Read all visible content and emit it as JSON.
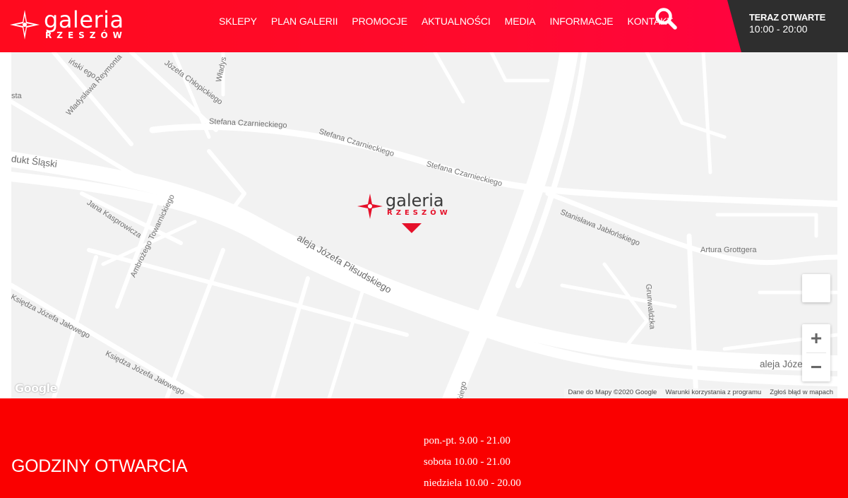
{
  "header": {
    "logo": {
      "line1": "galeria",
      "line2": "RZESZÓW"
    },
    "nav": [
      "SKLEPY",
      "PLAN GALERII",
      "PROMOCJE",
      "AKTUALNOŚCI",
      "MEDIA",
      "INFORMACJE",
      "KONTAKT"
    ],
    "search_icon": "search-icon",
    "open_now": {
      "label": "TERAZ OTWARTE",
      "hours": "10:00 - 20:00"
    }
  },
  "map": {
    "streets": [
      "iński ego",
      "Władysława Reymonta",
      "Józefa Chłopickiego",
      "Władys",
      "sta",
      "Stefana Czarnieckiego",
      "Stefana Czarnieckiego",
      "Stefana Czarnieckiego",
      "dukt Śląski",
      "Jana Kasprowicza",
      "Ambrożego Towarnickiego",
      "aleja Józefa Piłsudskiego",
      "Stanisława Jabłońskiego",
      "Artura Grottgera",
      "Grunwaldzka",
      "Księdza Józefa Jałowego",
      "Księdza Józefa Jałowego",
      "aleja Józe",
      "kiego"
    ],
    "pin": {
      "line1": "galeria",
      "line2": "RZESZÓW"
    },
    "controls": {
      "zoom_in": "+",
      "zoom_out": "−"
    },
    "google_logo": "Google",
    "attribution": [
      "Dane do Mapy ©2020 Google",
      "Warunki korzystania z programu",
      "Zgłoś błąd w mapach"
    ]
  },
  "footer": {
    "title": "GODZINY OTWARCIA",
    "hours": [
      "pon.-pt. 9.00 - 21.00",
      "sobota 10.00 - 21.00",
      "niedziela 10.00 - 20.00"
    ]
  },
  "colors": {
    "brand_red": "#ff0a1e",
    "footer_red": "#fa0000",
    "dark": "#2e2e2e",
    "map_bg": "#f2f2f2"
  }
}
